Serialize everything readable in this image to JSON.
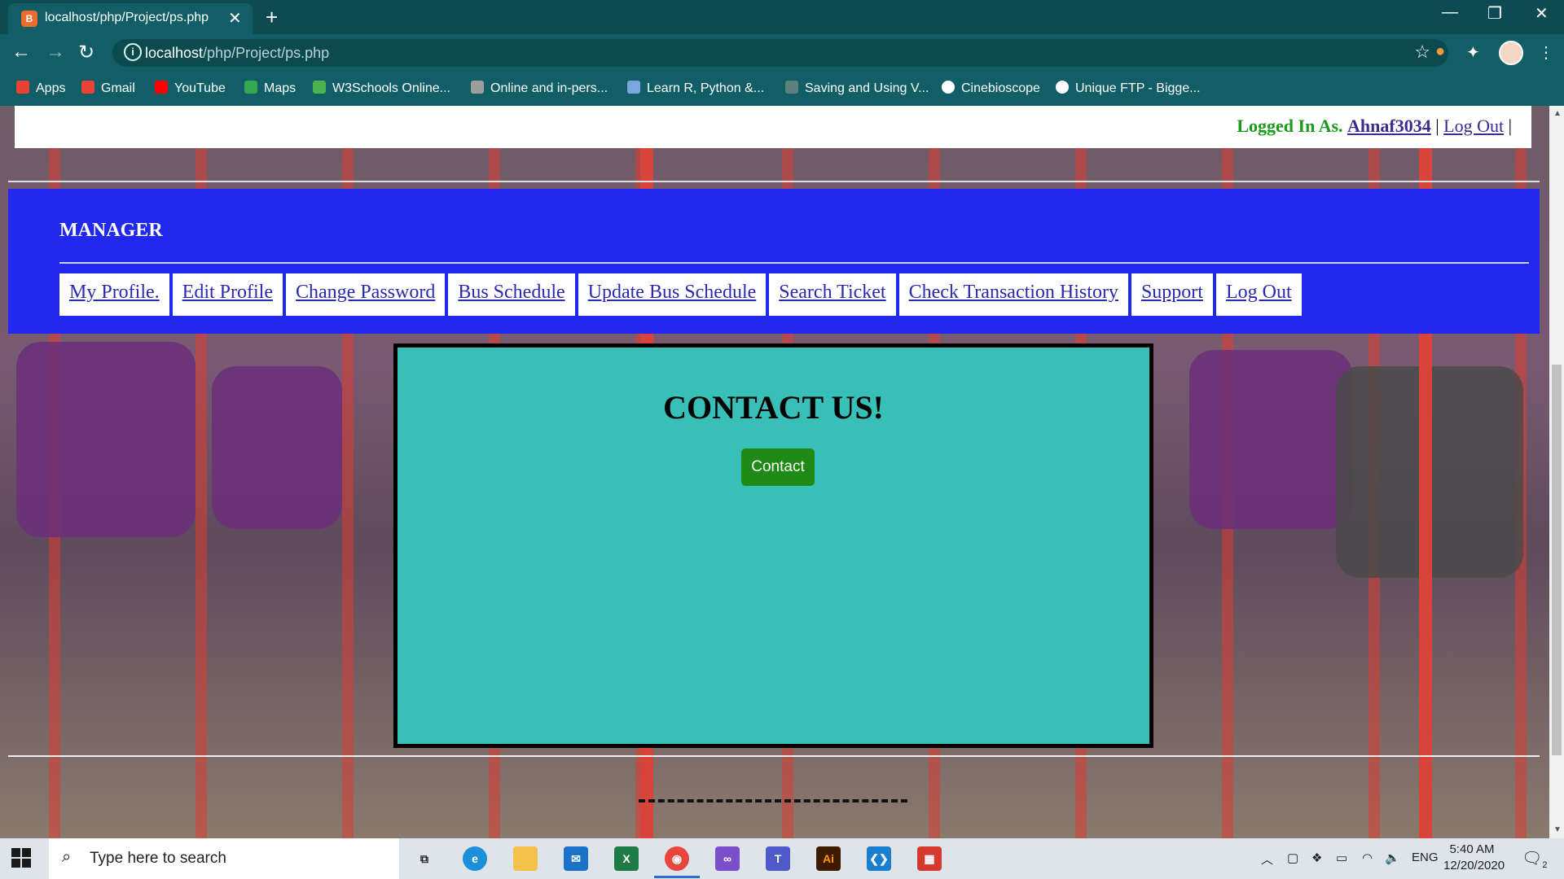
{
  "browser": {
    "tab_title": "localhost/php/Project/ps.php",
    "favicon_text": "B",
    "url_host": "localhost",
    "url_path": "/php/Project/ps.php",
    "bookmarks": [
      "Apps",
      "Gmail",
      "YouTube",
      "Maps",
      "W3Schools Online...",
      "Online and in-pers...",
      "Learn R, Python &...",
      "Saving and Using V...",
      "Cinebioscope",
      "Unique FTP - Bigge..."
    ]
  },
  "header": {
    "logged_in_label": "Logged In As.",
    "username": "Ahnaf3034",
    "separator": "|",
    "logout_label": "Log Out",
    "separator_end": "|"
  },
  "manager": {
    "heading": "MANAGER",
    "menu": [
      "My Profile.",
      "Edit Profile",
      "Change Password",
      "Bus Schedule",
      "Update Bus Schedule",
      "Search Ticket",
      "Check Transaction History",
      "Support",
      "Log Out"
    ]
  },
  "contact": {
    "title": "CONTACT US!",
    "button_label": "Contact"
  },
  "taskbar": {
    "search_placeholder": "Type here to search",
    "language": "ENG",
    "time": "5:40 AM",
    "date": "12/20/2020",
    "notification_count": "2"
  },
  "colors": {
    "manager_bar": "#2229ee",
    "contact_box": "#38bfb8",
    "contact_button": "#1f8b16",
    "logged_in_label": "#1b9a1b"
  }
}
